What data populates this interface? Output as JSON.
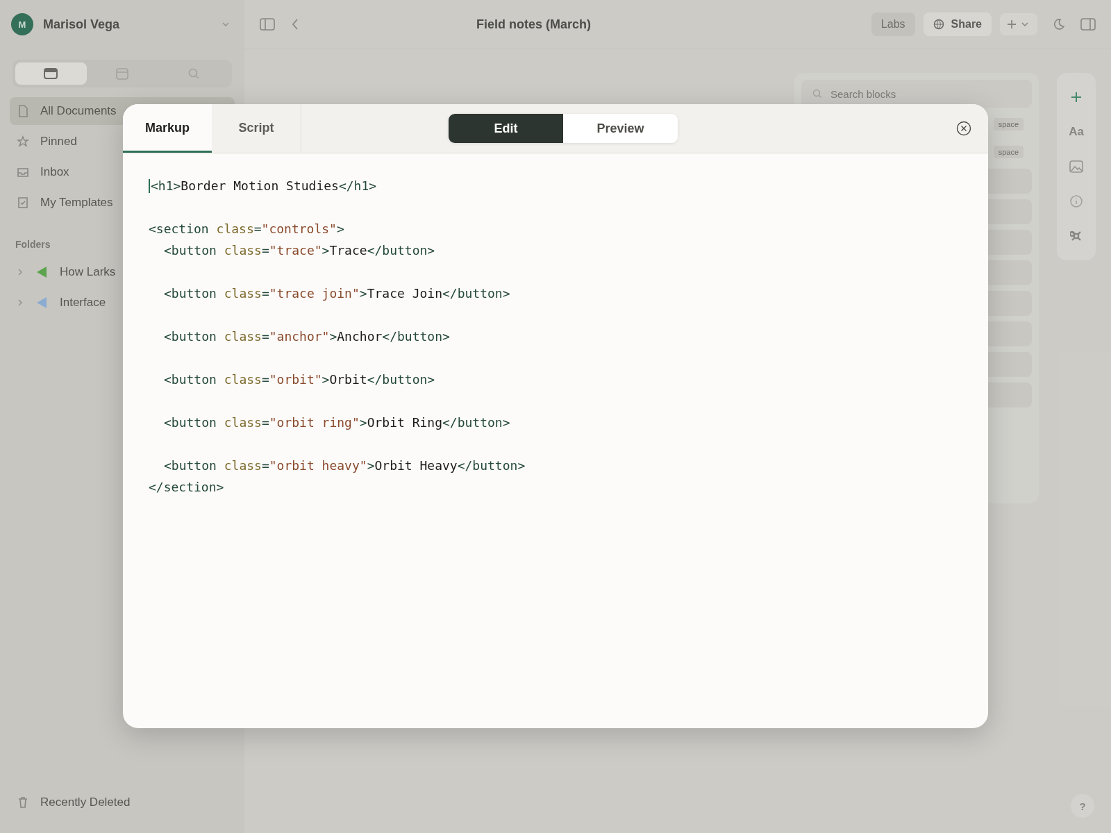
{
  "sidebar": {
    "user": {
      "initial": "M",
      "name": "Marisol Vega"
    },
    "view_tabs": [
      {
        "kind": "card",
        "selected": true
      },
      {
        "kind": "calendar",
        "selected": false
      },
      {
        "kind": "search",
        "selected": false
      }
    ],
    "items": [
      {
        "label": "All Documents",
        "kind": "document",
        "selected": true
      },
      {
        "label": "Pinned",
        "kind": "star",
        "selected": false
      },
      {
        "label": "Inbox",
        "kind": "inbox",
        "selected": false
      },
      {
        "label": "My Templates",
        "kind": "template",
        "selected": false
      }
    ],
    "folders_heading": "Folders",
    "folders": [
      {
        "label": "How Larks",
        "color": "#5aa84a",
        "expanded": false
      },
      {
        "label": "Interface",
        "color": "#8fb0d8",
        "expanded": false
      }
    ],
    "footer": "Recently Deleted"
  },
  "topbar": {
    "title": "Field notes (March)",
    "labs": "Labs",
    "share": "Share"
  },
  "blocks_panel": {
    "search": {
      "placeholder": "Search blocks"
    },
    "shortcuts": [
      "space",
      "space"
    ]
  },
  "toolbar": {
    "font_label": "Aa"
  },
  "help": "?",
  "modal": {
    "tabs": [
      {
        "label": "Markup",
        "selected": true
      },
      {
        "label": "Script",
        "selected": false
      }
    ],
    "modes": [
      {
        "label": "Edit",
        "selected": true
      },
      {
        "label": "Preview",
        "selected": false
      }
    ],
    "code": [
      {
        "kind": "line",
        "indented": false,
        "cursor": true,
        "tokens": [
          {
            "kind": "tag",
            "text": "<h1>"
          },
          {
            "kind": "text",
            "text": "Border Motion Studies"
          },
          {
            "kind": "tag",
            "text": "</h1>"
          }
        ]
      },
      {
        "kind": "blank"
      },
      {
        "kind": "line",
        "indented": false,
        "cursor": false,
        "tokens": [
          {
            "kind": "tag",
            "text": "<section "
          },
          {
            "kind": "attr",
            "text": "class"
          },
          {
            "kind": "tag",
            "text": "="
          },
          {
            "kind": "string",
            "text": "\"controls\""
          },
          {
            "kind": "tag",
            "text": ">"
          }
        ]
      },
      {
        "kind": "line",
        "indented": true,
        "cursor": false,
        "tokens": [
          {
            "kind": "tag",
            "text": "<button "
          },
          {
            "kind": "attr",
            "text": "class"
          },
          {
            "kind": "tag",
            "text": "="
          },
          {
            "kind": "string",
            "text": "\"trace\""
          },
          {
            "kind": "tag",
            "text": ">"
          },
          {
            "kind": "text",
            "text": "Trace"
          },
          {
            "kind": "tag",
            "text": "</button>"
          }
        ]
      },
      {
        "kind": "blank"
      },
      {
        "kind": "line",
        "indented": true,
        "cursor": false,
        "tokens": [
          {
            "kind": "tag",
            "text": "<button "
          },
          {
            "kind": "attr",
            "text": "class"
          },
          {
            "kind": "tag",
            "text": "="
          },
          {
            "kind": "string",
            "text": "\"trace join\""
          },
          {
            "kind": "tag",
            "text": ">"
          },
          {
            "kind": "text",
            "text": "Trace Join"
          },
          {
            "kind": "tag",
            "text": "</button>"
          }
        ]
      },
      {
        "kind": "blank"
      },
      {
        "kind": "line",
        "indented": true,
        "cursor": false,
        "tokens": [
          {
            "kind": "tag",
            "text": "<button "
          },
          {
            "kind": "attr",
            "text": "class"
          },
          {
            "kind": "tag",
            "text": "="
          },
          {
            "kind": "string",
            "text": "\"anchor\""
          },
          {
            "kind": "tag",
            "text": ">"
          },
          {
            "kind": "text",
            "text": "Anchor"
          },
          {
            "kind": "tag",
            "text": "</button>"
          }
        ]
      },
      {
        "kind": "blank"
      },
      {
        "kind": "line",
        "indented": true,
        "cursor": false,
        "tokens": [
          {
            "kind": "tag",
            "text": "<button "
          },
          {
            "kind": "attr",
            "text": "class"
          },
          {
            "kind": "tag",
            "text": "="
          },
          {
            "kind": "string",
            "text": "\"orbit\""
          },
          {
            "kind": "tag",
            "text": ">"
          },
          {
            "kind": "text",
            "text": "Orbit"
          },
          {
            "kind": "tag",
            "text": "</button>"
          }
        ]
      },
      {
        "kind": "blank"
      },
      {
        "kind": "line",
        "indented": true,
        "cursor": false,
        "tokens": [
          {
            "kind": "tag",
            "text": "<button "
          },
          {
            "kind": "attr",
            "text": "class"
          },
          {
            "kind": "tag",
            "text": "="
          },
          {
            "kind": "string",
            "text": "\"orbit ring\""
          },
          {
            "kind": "tag",
            "text": ">"
          },
          {
            "kind": "text",
            "text": "Orbit Ring"
          },
          {
            "kind": "tag",
            "text": "</button>"
          }
        ]
      },
      {
        "kind": "blank"
      },
      {
        "kind": "line",
        "indented": true,
        "cursor": false,
        "tokens": [
          {
            "kind": "tag",
            "text": "<button "
          },
          {
            "kind": "attr",
            "text": "class"
          },
          {
            "kind": "tag",
            "text": "="
          },
          {
            "kind": "string",
            "text": "\"orbit heavy\""
          },
          {
            "kind": "tag",
            "text": ">"
          },
          {
            "kind": "text",
            "text": "Orbit Heavy"
          },
          {
            "kind": "tag",
            "text": "</button>"
          }
        ]
      },
      {
        "kind": "line",
        "indented": false,
        "cursor": false,
        "tokens": [
          {
            "kind": "tag",
            "text": "</section>"
          }
        ]
      }
    ]
  }
}
